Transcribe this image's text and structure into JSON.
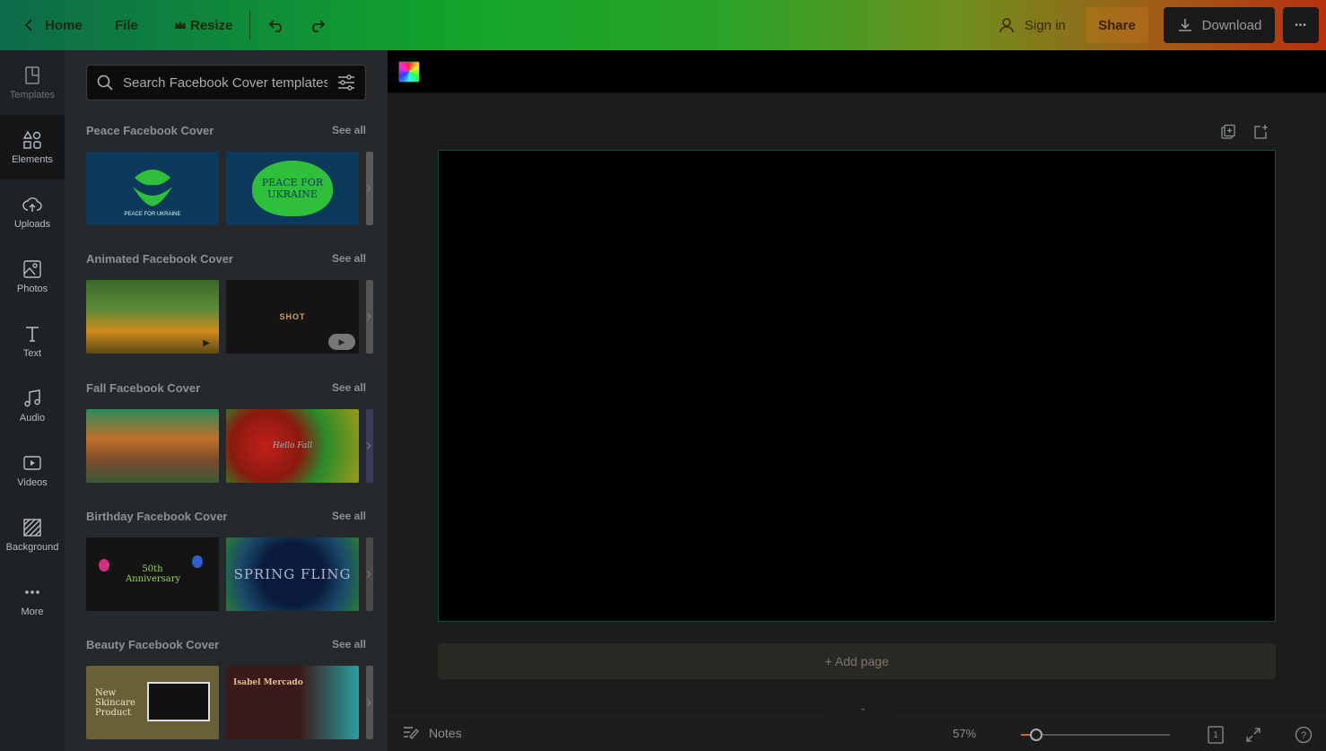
{
  "topbar": {
    "home_label": "Home",
    "file_label": "File",
    "resize_label": "Resize",
    "signin_label": "Sign in",
    "share_label": "Share",
    "download_label": "Download",
    "more_label": "•••"
  },
  "leftnav": {
    "items": [
      {
        "label": "Templates",
        "icon": "templates-icon"
      },
      {
        "label": "Elements",
        "icon": "elements-icon"
      },
      {
        "label": "Uploads",
        "icon": "upload-cloud-icon"
      },
      {
        "label": "Photos",
        "icon": "photo-icon"
      },
      {
        "label": "Text",
        "icon": "text-icon"
      },
      {
        "label": "Audio",
        "icon": "music-note-icon"
      },
      {
        "label": "Videos",
        "icon": "video-icon"
      },
      {
        "label": "Background",
        "icon": "background-pattern-icon"
      },
      {
        "label": "More",
        "icon": "more-dots-icon"
      }
    ]
  },
  "panel": {
    "search_placeholder": "Search Facebook Cover templates",
    "see_all": "See all",
    "sections": [
      {
        "title": "Peace Facebook Cover",
        "thumbs": [
          {
            "text": "PEACE FOR UKRAINE"
          },
          {
            "text": "PEACE FOR UKRAINE"
          }
        ]
      },
      {
        "title": "Animated Facebook Cover",
        "thumbs": [
          {
            "text": ""
          },
          {
            "text": "SHOT"
          }
        ]
      },
      {
        "title": "Fall Facebook Cover",
        "thumbs": [
          {
            "text": ""
          },
          {
            "text": "Hello Fall"
          }
        ]
      },
      {
        "title": "Birthday Facebook Cover",
        "thumbs": [
          {
            "text": "50th Anniversary"
          },
          {
            "text": "SPRING FLING"
          }
        ]
      },
      {
        "title": "Beauty Facebook Cover",
        "thumbs": [
          {
            "text": "New Skincare Product"
          },
          {
            "text": "Isabel Mercado"
          }
        ]
      }
    ]
  },
  "editor": {
    "add_page_label": "+ Add page",
    "notes_label": "Notes",
    "zoom_label": "57%",
    "zoom_value": 0.1,
    "page_number": "1"
  },
  "colors": {
    "panel_bg": "#26292b",
    "nav_bg": "#1f2224",
    "canvas_border": "#0f4a3a",
    "accent": "#d06a1a"
  }
}
